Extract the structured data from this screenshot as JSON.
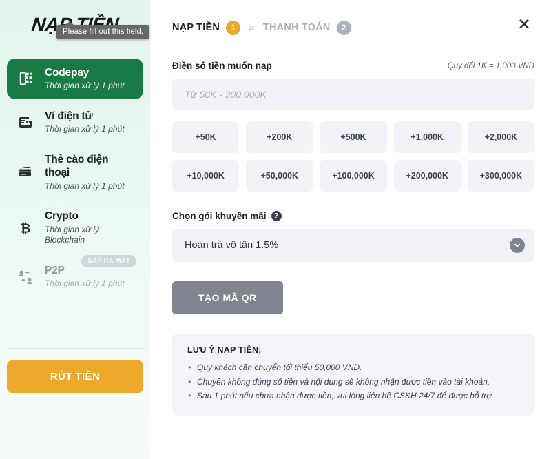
{
  "sidebar": {
    "brand_title": "NẠP TIỀN",
    "tooltip": "Please fill out this field.",
    "methods": [
      {
        "title": "Codepay",
        "sub": "Thời gian xử lý 1 phút",
        "icon": "qr-phone-icon",
        "active": true,
        "badge": ""
      },
      {
        "title": "Ví điện tử",
        "sub": "Thời gian xử lý 1 phút",
        "icon": "wallet-icon",
        "active": false,
        "badge": ""
      },
      {
        "title": "Thẻ cào điện thoại",
        "sub": "Thời gian xử lý 1 phút",
        "icon": "cards-icon",
        "active": false,
        "badge": ""
      },
      {
        "title": "Crypto",
        "sub": "Thời gian xử lý Blockchain",
        "icon": "bitcoin-icon",
        "active": false,
        "badge": ""
      },
      {
        "title": "P2P",
        "sub": "Thời gian xử lý 1 phút",
        "icon": "p2p-icon",
        "active": false,
        "badge": "SẮP RA MẮT"
      }
    ],
    "withdraw_label": "RÚT TIỀN"
  },
  "header": {
    "step1_label": "NẠP TIỀN",
    "step1_number": "1",
    "separator": "»",
    "step2_label": "THANH TOÁN",
    "step2_number": "2",
    "close_glyph": "✕"
  },
  "form": {
    "amount_label": "Điền số tiền muốn nạp",
    "rate_note": "Quy đổi 1K = 1,000 VND",
    "amount_value": "",
    "amount_placeholder": "Từ 50K - 300,000K",
    "presets": [
      "+50K",
      "+200K",
      "+500K",
      "+1,000K",
      "+2,000K",
      "+10,000K",
      "+50,000K",
      "+100,000K",
      "+200,000K",
      "+300,000K"
    ],
    "promo_label": "Chọn gói khuyến mãi",
    "help_glyph": "?",
    "promo_value": "Hoàn trả vô tận 1.5%",
    "submit_label": "TẠO MÃ QR"
  },
  "notes": {
    "title": "LƯU Ý NẠP TIỀN:",
    "items": [
      "Quý khách cần chuyển tối thiểu 50,000 VND.",
      "Chuyển không đúng số tiền và nội dung sẽ không nhận được tiền vào tài khoản.",
      "Sau 1 phút nếu chưa nhận được tiền, vui lòng liên hệ CSKH 24/7 để được hỗ trợ."
    ]
  },
  "colors": {
    "accent_green": "#1a7a46",
    "accent_orange": "#eca92c",
    "muted_gray": "#aab2c0",
    "field_bg": "#f2f3f8"
  }
}
